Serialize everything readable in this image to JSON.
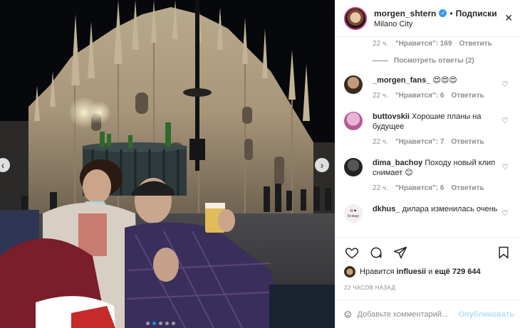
{
  "header": {
    "username": "morgen_shtern",
    "follow_label": "Подписки",
    "bullet": "•",
    "location": "Milano City",
    "more_label": "✕"
  },
  "top_meta": {
    "time": "22 ч.",
    "likes": "\"Нравится\": 169",
    "reply": "Ответить"
  },
  "view_replies": "Посмотреть ответы (2)",
  "comments": [
    {
      "user": "_morgen_fans_",
      "text": "😍😍😍",
      "time": "",
      "likes": "",
      "reply": "",
      "avatar": "#7a5a3f"
    },
    {
      "user": "buttovskii",
      "text": "Хорошие планы на будущее",
      "time": "22 ч.",
      "likes": "\"Нравится\": 7",
      "reply": "Ответить",
      "avatar": "#d07ab0"
    },
    {
      "user": "dima_bachoy",
      "text": "Походу новый клип снимает 😊",
      "time": "22 ч.",
      "likes": "\"Нравится\": 6",
      "reply": "Ответить",
      "avatar": "#3a3a3a"
    },
    {
      "user": "dkhus_",
      "text": "дилара изменилась очень",
      "time": "",
      "likes": "",
      "reply": "",
      "avatar": "#f7eef3"
    }
  ],
  "first_comment_meta": {
    "time": "22 ч.",
    "likes": "\"Нравится\": 6",
    "reply": "Ответить"
  },
  "avatar_text": "Я ❤ Ксюшу",
  "likes": {
    "prefix": "Нравится",
    "user": "influesii",
    "and": "и",
    "rest": "ещё 729 644"
  },
  "posted_time": "22 ЧАСОВ НАЗАД",
  "add_comment": {
    "placeholder": "Добавьте комментарий...",
    "publish": "Опубликовать"
  },
  "photo_alt": "Duomo di Milano at night",
  "colors": {
    "verified": "#3897f0",
    "publish": "#b2dffc",
    "meta": "#8e8e8e"
  }
}
